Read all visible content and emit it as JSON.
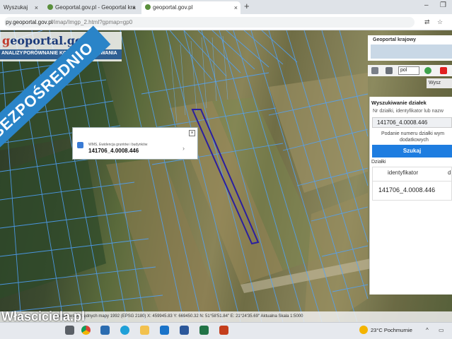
{
  "browser": {
    "tabs": [
      {
        "label": "Wyszukaj",
        "close": "×"
      },
      {
        "label": "Geoportal.gov.pl - Geoportal kra",
        "close": "×"
      },
      {
        "label": "geoportal.gov.pl",
        "close": "×"
      }
    ],
    "new_tab": "+",
    "window": {
      "minimize": "–",
      "restore": "❐"
    },
    "url_main": "py.geoportal.gov.pl",
    "url_rest": "/imap/Imgp_2.html?gpmap=gp0"
  },
  "site": {
    "logo_g": "g",
    "logo_rest": "eoportal.gov.pl",
    "menu": [
      "ANALIZY",
      "PORÓWNANIE",
      "KCH",
      "WYSZUKIWANIA"
    ]
  },
  "ribbon": "BEZPOŚREDNIO",
  "popup": {
    "close": "×",
    "layer": "WMS, Ewidencja gruntów i budynków",
    "parcel_id": "141706_4.0008.446",
    "arrow": "›"
  },
  "right_panel": {
    "header_title": "Geoportal krajowy",
    "language": "pol",
    "tab_label": "Wysz",
    "search": {
      "title": "Wyszukiwanie działek",
      "label": "Nr działki, identyfikator lub nazw",
      "value": "141706_4.0008.446",
      "hint_line1": "Podanie numeru działki wym",
      "hint_line2": "dodatkowych",
      "button": "Szukaj"
    },
    "results": {
      "section": "Działki",
      "col1": "identyfikator",
      "col2": "d",
      "rows": [
        "141706_4.0008.446"
      ]
    }
  },
  "status_bar": {
    "text": "układ współrzędnych mapy 1992 (EPSG 2180)   X: 459945.83  Y: 669450.32   N: 51°58'51.84\" E: 21°24'35.69\"   Aktualna Skala 1:5000"
  },
  "watermark": "Własciciela.pl",
  "taskbar": {
    "weather": "23°C  Pochmurnie",
    "tray_arrow": "^"
  },
  "colors": {
    "accent": "#1e7de0",
    "ribbon": "#2a84c8",
    "parcel_lines": "#4fa3ff",
    "selected_parcel": "#2a1fa0"
  }
}
